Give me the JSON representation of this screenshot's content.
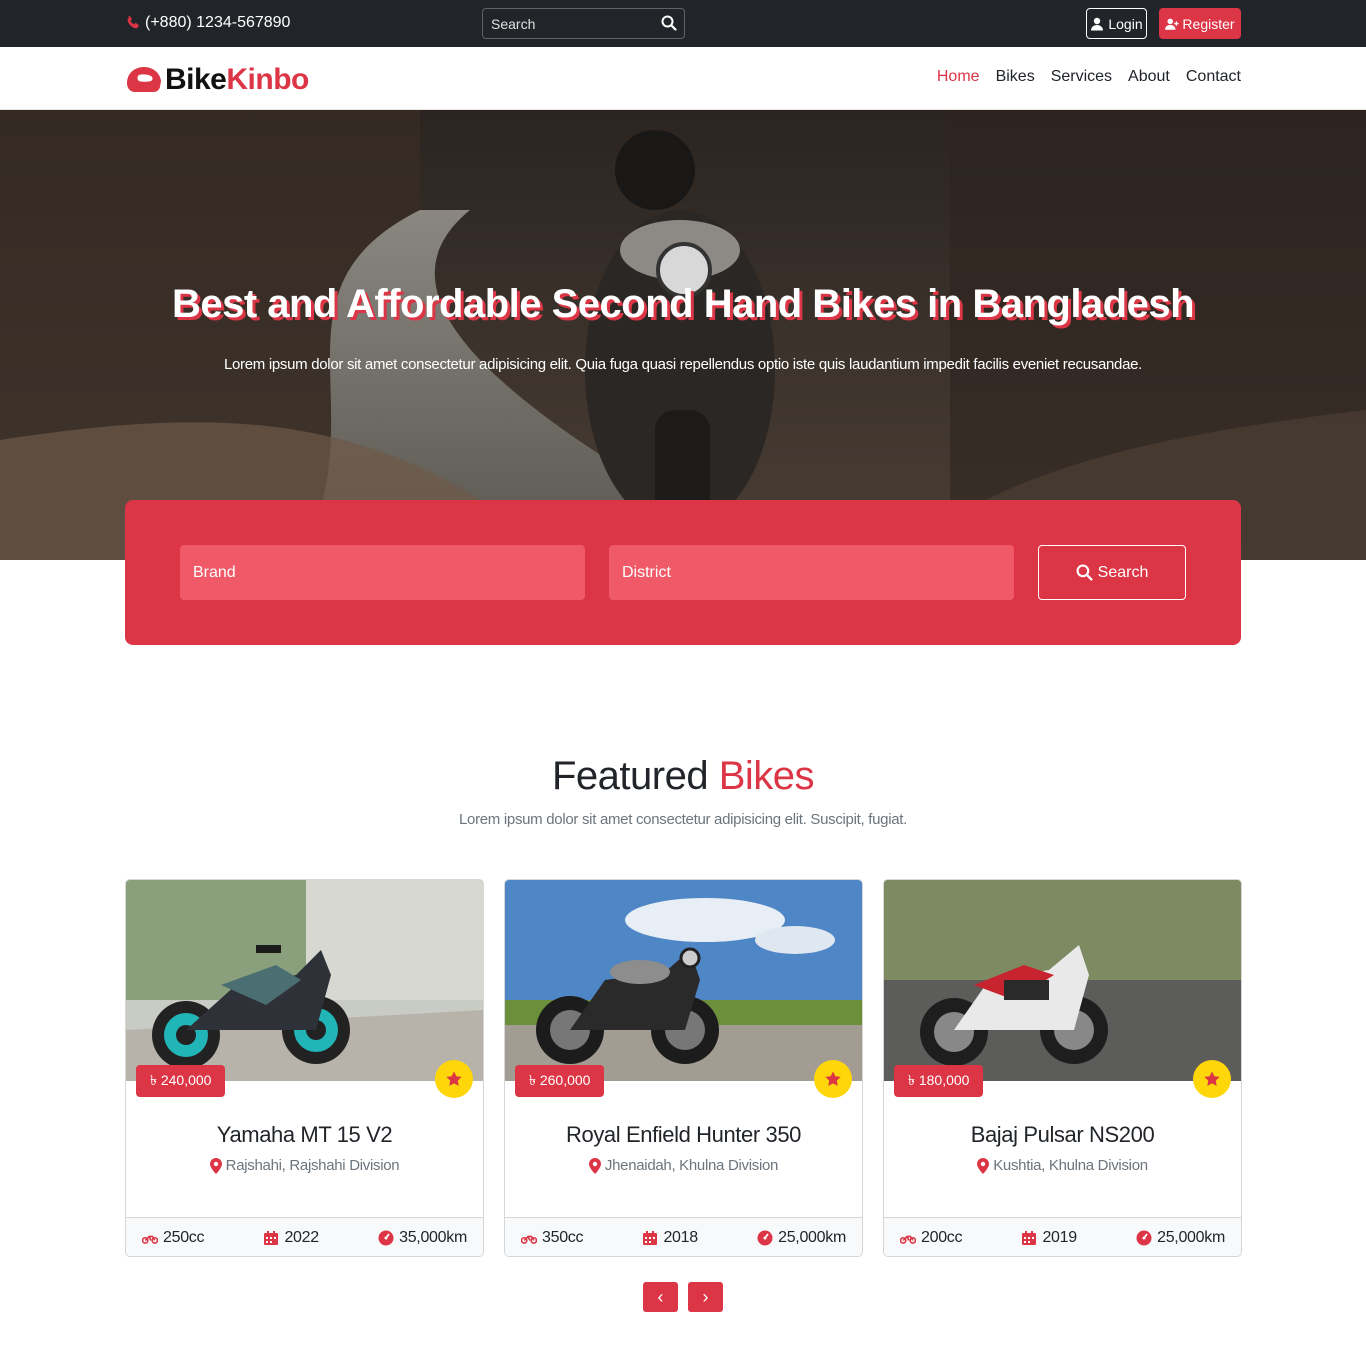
{
  "topbar": {
    "phone": "(+880) 1234-567890",
    "search_placeholder": "Search",
    "login_label": "Login",
    "register_label": "Register"
  },
  "navbar": {
    "brand_part1": "Bike",
    "brand_part2": "Kinbo",
    "links": [
      "Home",
      "Bikes",
      "Services",
      "About",
      "Contact"
    ],
    "active": "Home"
  },
  "hero": {
    "title": "Best and Affordable Second Hand Bikes in Bangladesh",
    "subtitle": "Lorem ipsum dolor sit amet consectetur adipisicing elit. Quia fuga quasi repellendus optio iste quis laudantium impedit facilis eveniet recusandae."
  },
  "search_panel": {
    "brand_placeholder": "Brand",
    "district_placeholder": "District",
    "search_label": "Search"
  },
  "featured": {
    "title_part1": "Featured",
    "title_part2": "Bikes",
    "subtitle": "Lorem ipsum dolor sit amet consectetur adipisicing elit. Suscipit, fugiat.",
    "cards": [
      {
        "price": "৳ 240,000",
        "name": "Yamaha MT 15 V2",
        "location": "Rajshahi, Rajshahi Division",
        "cc": "250cc",
        "year": "2022",
        "km": "35,000km"
      },
      {
        "price": "৳ 260,000",
        "name": "Royal Enfield Hunter 350",
        "location": "Jhenaidah, Khulna Division",
        "cc": "350cc",
        "year": "2018",
        "km": "25,000km"
      },
      {
        "price": "৳ 180,000",
        "name": "Bajaj Pulsar NS200",
        "location": "Kushtia, Khulna Division",
        "cc": "200cc",
        "year": "2019",
        "km": "25,000km"
      }
    ]
  },
  "pager": {
    "prev": "‹",
    "next": "›"
  },
  "colors": {
    "accent": "#dc3545",
    "dark": "#212529",
    "star": "#ffd60a"
  }
}
